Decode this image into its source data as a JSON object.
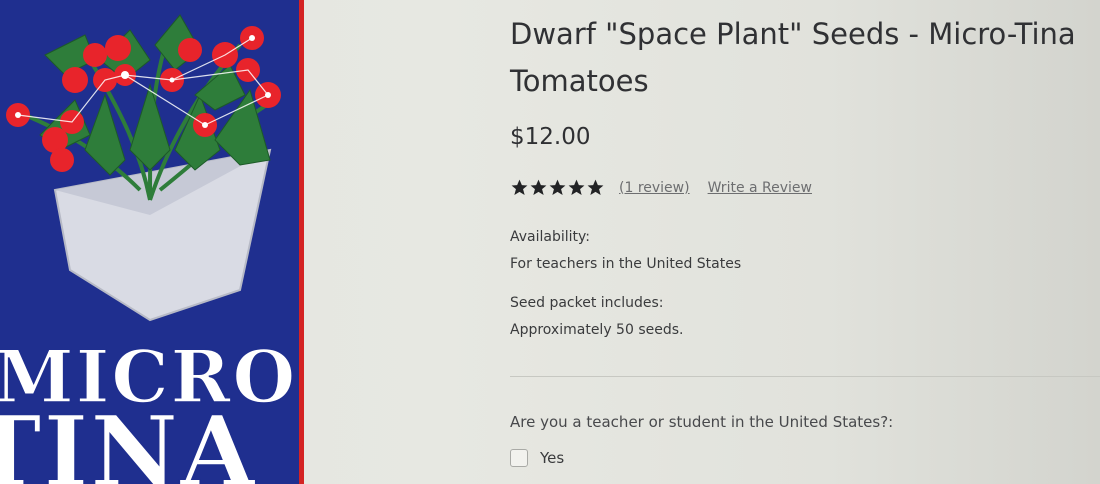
{
  "product": {
    "title": "Dwarf \"Space Plant\" Seeds - Micro-Tina Tomatoes",
    "price": "$12.00",
    "image": {
      "logo_line1": "MICRO",
      "logo_line2": "TINA",
      "colors": {
        "background": "#1f2f8f",
        "border": "#d42323",
        "fruit": "#e8242b",
        "leaf": "#2e7d3a",
        "pot": "#d9dbe4"
      }
    }
  },
  "rating": {
    "stars": 5,
    "max": 5,
    "star_icon": "star-icon",
    "review_count_label": "(1 review)",
    "write_review_label": "Write a Review"
  },
  "details": {
    "availability_label": "Availability:",
    "availability_value": "For teachers in the United States",
    "seed_label": "Seed packet includes:",
    "seed_value": "Approximately 50 seeds."
  },
  "form": {
    "question": "Are you a teacher or student in the United States?:",
    "yes_label": "Yes"
  }
}
